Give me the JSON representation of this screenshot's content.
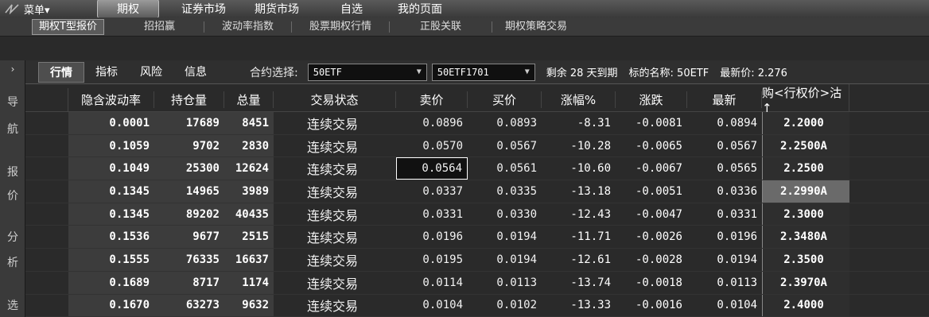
{
  "topbar": {
    "menu_label": "菜单▾",
    "nav": [
      "期权",
      "证券市场",
      "期货市场",
      "自选",
      "我的页面"
    ]
  },
  "subbar": {
    "items": [
      "期权T型报价",
      "招招赢",
      "波动率指数",
      "股票期权行情",
      "正股关联",
      "期权策略交易"
    ]
  },
  "leftstrip": {
    "arrow": "›",
    "chars": [
      "导",
      "航",
      "报",
      "价",
      "分",
      "析",
      "选"
    ]
  },
  "toolbar": {
    "tabs": [
      "行情",
      "指标",
      "风险",
      "信息"
    ],
    "contract_label": "合约选择:",
    "underlying_select": "50ETF",
    "contract_select": "50ETF1701",
    "remaining": "剩余 28 天到期",
    "underlying_name": "标的名称: 50ETF",
    "last_price": "最新价: 2.276"
  },
  "table": {
    "headers": [
      "隐含波动率",
      "持仓量",
      "总量",
      "交易状态",
      "卖价",
      "买价",
      "涨幅%",
      "涨跌",
      "最新",
      "购<行权价>沽↑"
    ],
    "rows": [
      {
        "iv": "0.0001",
        "oi": "17689",
        "vol": "8451",
        "state": "连续交易",
        "sell": "0.0896",
        "buy": "0.0893",
        "pct": "-8.31",
        "chg": "-0.0081",
        "last": "0.0894",
        "strike": "2.2000"
      },
      {
        "iv": "0.1059",
        "oi": "9702",
        "vol": "2830",
        "state": "连续交易",
        "sell": "0.0570",
        "buy": "0.0567",
        "pct": "-10.28",
        "chg": "-0.0065",
        "last": "0.0567",
        "strike": "2.2500A"
      },
      {
        "iv": "0.1049",
        "oi": "25300",
        "vol": "12624",
        "state": "连续交易",
        "sell": "0.0564",
        "buy": "0.0561",
        "pct": "-10.60",
        "chg": "-0.0067",
        "last": "0.0565",
        "strike": "2.2500"
      },
      {
        "iv": "0.1345",
        "oi": "14965",
        "vol": "3989",
        "state": "连续交易",
        "sell": "0.0337",
        "buy": "0.0335",
        "pct": "-13.18",
        "chg": "-0.0051",
        "last": "0.0336",
        "strike": "2.2990A"
      },
      {
        "iv": "0.1345",
        "oi": "89202",
        "vol": "40435",
        "state": "连续交易",
        "sell": "0.0331",
        "buy": "0.0330",
        "pct": "-12.43",
        "chg": "-0.0047",
        "last": "0.0331",
        "strike": "2.3000"
      },
      {
        "iv": "0.1536",
        "oi": "9677",
        "vol": "2515",
        "state": "连续交易",
        "sell": "0.0196",
        "buy": "0.0194",
        "pct": "-11.71",
        "chg": "-0.0026",
        "last": "0.0196",
        "strike": "2.3480A"
      },
      {
        "iv": "0.1555",
        "oi": "76335",
        "vol": "16637",
        "state": "连续交易",
        "sell": "0.0195",
        "buy": "0.0194",
        "pct": "-12.61",
        "chg": "-0.0028",
        "last": "0.0194",
        "strike": "2.3500"
      },
      {
        "iv": "0.1689",
        "oi": "8717",
        "vol": "1174",
        "state": "连续交易",
        "sell": "0.0114",
        "buy": "0.0113",
        "pct": "-13.74",
        "chg": "-0.0018",
        "last": "0.0113",
        "strike": "2.3970A"
      },
      {
        "iv": "0.1670",
        "oi": "63273",
        "vol": "9632",
        "state": "连续交易",
        "sell": "0.0104",
        "buy": "0.0102",
        "pct": "-13.33",
        "chg": "-0.0016",
        "last": "0.0104",
        "strike": "2.4000"
      }
    ]
  }
}
